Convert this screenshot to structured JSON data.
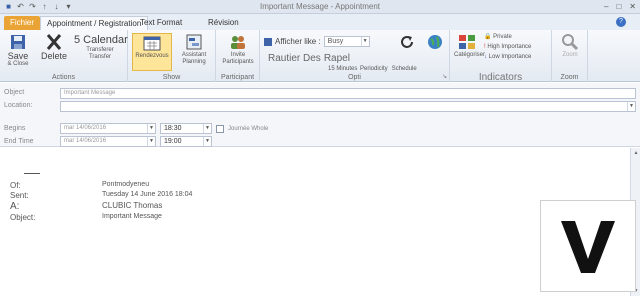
{
  "titlebar": {
    "title": "Important Message - Appointment",
    "qat_icons": [
      "save-icon",
      "undo-icon",
      "redo-icon",
      "up-arrow-icon",
      "down-arrow-icon",
      "customize-icon"
    ]
  },
  "tabs": {
    "file": "Fichier",
    "appointment": "Appointment / Registration",
    "format": "Text Format",
    "review": "Révision"
  },
  "ribbon": {
    "actions": {
      "label": "Actions",
      "save": "Save",
      "save_sub": "& Close",
      "delete": "Delete",
      "calendar": "5 Calendar",
      "forward": "Transferer",
      "forward_sub": "Transfer"
    },
    "show": {
      "label": "Show",
      "appointment": "Rendezvous",
      "assistant": "Assistant",
      "assistant_sub": "Planning"
    },
    "attendees": {
      "label": "Participant",
      "invite": "Invite",
      "invite_sub": "Participants"
    },
    "options": {
      "label": "Opti",
      "show_as_label": "Afficher like :",
      "show_as_value": "Busy",
      "reminder_label": "Rapel",
      "reminder_value": "15 Minutes",
      "recurrence": "Periodicity",
      "timezones": "Schedule",
      "fuseau": "Fuseau horaire"
    },
    "tags": {
      "label": "Indicators",
      "categorize": "Catégoriser",
      "private": "Private",
      "high": "High Importance",
      "low": "Low Importance"
    },
    "zoom": {
      "label": "Zoom",
      "zoom": "Zoom"
    },
    "stray": "Rautier Des"
  },
  "form": {
    "subject_label": "Object",
    "subject_value": "Important Message",
    "location_label": "Location:",
    "location_value": "",
    "start_label": "Begins",
    "start_date": "mar 14/06/2016",
    "start_time": "18:30",
    "allday": "Journée Whole",
    "end_label": "End Time",
    "end_date": "mar 14/06/2016",
    "end_time": "19:00"
  },
  "message": {
    "rows": [
      {
        "k": "Of:",
        "v": "Pontmodyeneu"
      },
      {
        "k": "Sent:",
        "v": "Tuesday 14 June 2016 18:04"
      },
      {
        "k": "A:",
        "v": "CLUBIC Thomas"
      },
      {
        "k": "Object:",
        "v": "Important Message"
      }
    ]
  },
  "colors": {
    "file_tab": "#e9a435",
    "ribbon_bg": "#e4eaf2",
    "selected": "#fde59a"
  }
}
